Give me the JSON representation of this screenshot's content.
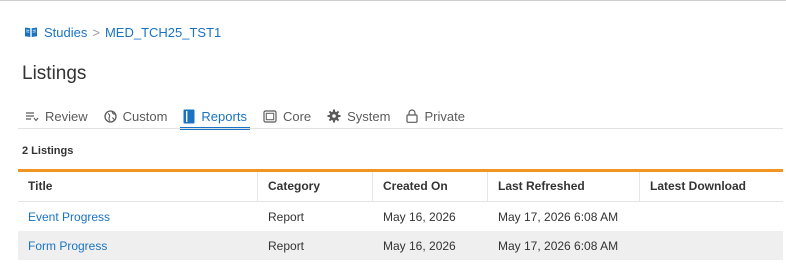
{
  "breadcrumb": {
    "root": "Studies",
    "separator": ">",
    "current": "MED_TCH25_TST1"
  },
  "page": {
    "title": "Listings"
  },
  "tabs": [
    {
      "label": "Review",
      "icon": "review-sort-icon",
      "active": false
    },
    {
      "label": "Custom",
      "icon": "globe-icon",
      "active": false
    },
    {
      "label": "Reports",
      "icon": "report-book-icon",
      "active": true
    },
    {
      "label": "Core",
      "icon": "window-icon",
      "active": false
    },
    {
      "label": "System",
      "icon": "gear-icon",
      "active": false
    },
    {
      "label": "Private",
      "icon": "lock-icon",
      "active": false
    }
  ],
  "listing_count": "2 Listings",
  "table": {
    "columns": [
      "Title",
      "Category",
      "Created On",
      "Last Refreshed",
      "Latest Download"
    ],
    "rows": [
      {
        "title": "Event Progress",
        "category": "Report",
        "created_on": "May 16, 2026",
        "last_refreshed": "May 17, 2026 6:08 AM",
        "latest_download": ""
      },
      {
        "title": "Form Progress",
        "category": "Report",
        "created_on": "May 16, 2026",
        "last_refreshed": "May 17, 2026 6:08 AM",
        "latest_download": ""
      }
    ]
  },
  "colors": {
    "accent": "#1a73c2",
    "table_header_rule": "#f0951f",
    "alt_row": "#efefef"
  }
}
